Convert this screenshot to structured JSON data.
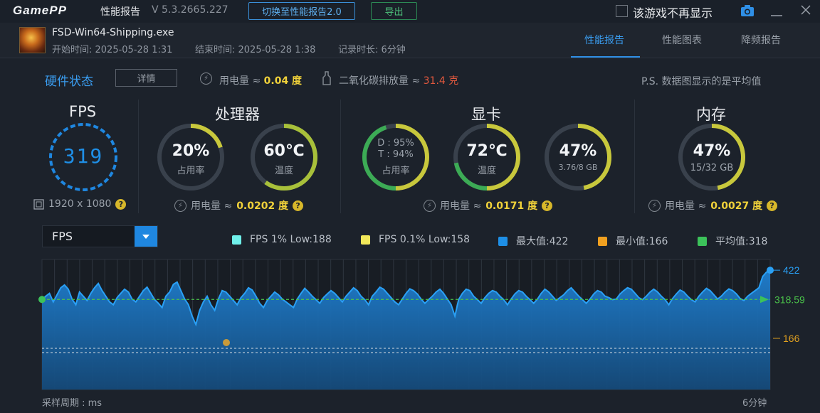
{
  "titlebar": {
    "logo": "GamePP",
    "title": "性能报告",
    "version": "V 5.3.2665.227",
    "switch_btn": "切换至性能报告2.0",
    "export_btn": "导出",
    "dont_show": "该游戏不再显示"
  },
  "info": {
    "exe": "FSD-Win64-Shipping.exe",
    "start": "开始时间: 2025-05-28 1:31",
    "end": "结束时间: 2025-05-28 1:38",
    "duration": "记录时长: 6分钟",
    "tabs": [
      "性能报告",
      "性能图表",
      "降频报告"
    ]
  },
  "hw": {
    "title": "硬件状态",
    "detail_btn": "详情",
    "power_label": "用电量 ≈",
    "power_value": "0.04 度",
    "co2_label": "二氧化碳排放量 ≈",
    "co2_value": "31.4 克",
    "note": "P.S. 数据图显示的是平均值"
  },
  "fps": {
    "title": "FPS",
    "value": "319",
    "resolution": "1920 x 1080"
  },
  "cpu": {
    "title": "处理器",
    "usage": "20%",
    "usage_label": "占用率",
    "usage_frac": 0.2,
    "temp": "60℃",
    "temp_label": "温度",
    "temp_frac": 0.6,
    "power_label": "用电量 ≈",
    "power_value": "0.0202 度"
  },
  "gpu": {
    "title": "显卡",
    "d": "D : 95%",
    "t": "T : 94%",
    "usage_label": "占用率",
    "usage_frac": 0.95,
    "temp": "72℃",
    "temp_label": "温度",
    "temp_frac": 0.72,
    "mem": "47%",
    "mem_sub": "3.76/8 GB",
    "mem_frac": 0.47,
    "power_label": "用电量 ≈",
    "power_value": "0.0171 度"
  },
  "ram": {
    "title": "内存",
    "value": "47%",
    "sub": "15/32 GB",
    "frac": 0.47,
    "power_label": "用电量 ≈",
    "power_value": "0.0027 度"
  },
  "chart_controls": {
    "selected": "FPS",
    "legend": [
      {
        "label": "FPS 1% Low:188",
        "color": "#6ff0ea"
      },
      {
        "label": "FPS 0.1% Low:158",
        "color": "#f2e85a"
      },
      {
        "label": "最大值:422",
        "color": "#1e8fe6"
      },
      {
        "label": "最小值:166",
        "color": "#f0a020"
      },
      {
        "label": "平均值:318",
        "color": "#3cc25a"
      }
    ]
  },
  "chart_data": {
    "type": "area",
    "series": [
      {
        "name": "FPS",
        "values": [
          318,
          330,
          340,
          310,
          335,
          360,
          370,
          355,
          320,
          300,
          345,
          330,
          315,
          340,
          360,
          375,
          350,
          330,
          310,
          300,
          325,
          340,
          355,
          345,
          320,
          310,
          330,
          350,
          362,
          340,
          318,
          305,
          290,
          330,
          345,
          372,
          380,
          350,
          320,
          300,
          260,
          230,
          280,
          310,
          330,
          300,
          280,
          320,
          350,
          345,
          330,
          315,
          300,
          325,
          340,
          360,
          352,
          330,
          305,
          290,
          315,
          330,
          345,
          335,
          320,
          310,
          300,
          290,
          320,
          340,
          358,
          345,
          330,
          318,
          305,
          325,
          338,
          350,
          340,
          325,
          310,
          330,
          345,
          360,
          350,
          330,
          318,
          300,
          330,
          345,
          362,
          355,
          340,
          325,
          310,
          300,
          320,
          340,
          356,
          350,
          338,
          320,
          305,
          318,
          330,
          345,
          355,
          340,
          320,
          300,
          260,
          318,
          340,
          355,
          350,
          330,
          318,
          305,
          325,
          340,
          350,
          345,
          330,
          318,
          300,
          320,
          338,
          350,
          345,
          330,
          318,
          305,
          320,
          340,
          355,
          345,
          330,
          315,
          325,
          335,
          350,
          360,
          345,
          330,
          318,
          305,
          320,
          338,
          350,
          345,
          330,
          325,
          318,
          320,
          338,
          350,
          360,
          355,
          340,
          325,
          318,
          330,
          345,
          355,
          345,
          330,
          318,
          300,
          322,
          338,
          352,
          345,
          330,
          318,
          310,
          330,
          345,
          358,
          350,
          335,
          320,
          330,
          345,
          356,
          350,
          338,
          322,
          315,
          330,
          340,
          350,
          360,
          400,
          415,
          422
        ]
      }
    ],
    "annotations": {
      "max": 422,
      "avg": "318.59",
      "min": 166
    },
    "ylim": [
      0,
      460
    ],
    "xlabel_left": "采样周期 : ms",
    "xlabel_right": "6分钟"
  }
}
